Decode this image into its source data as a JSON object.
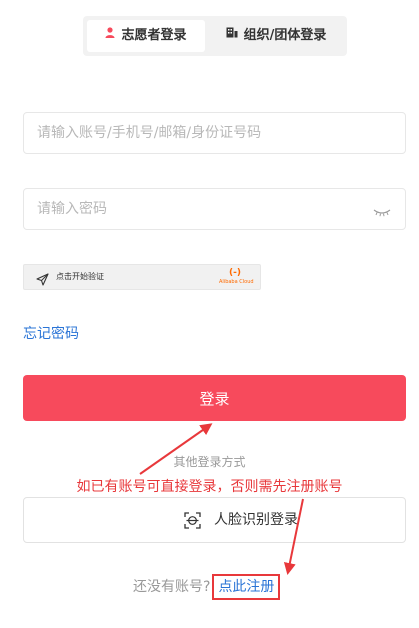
{
  "tabs": {
    "volunteer_label": "志愿者登录",
    "org_label": "组织/团体登录"
  },
  "form": {
    "account_placeholder": "请输入账号/手机号/邮箱/身份证号码",
    "password_placeholder": "请输入密码"
  },
  "captcha": {
    "label": "点击开始验证",
    "brand": "Alibaba Cloud"
  },
  "links": {
    "forgot_password": "忘记密码",
    "register_prompt": "还没有账号?",
    "register_link": "点此注册"
  },
  "buttons": {
    "login": "登录",
    "face_login": "人脸识别登录"
  },
  "other_methods_label": "其他登录方式",
  "annotation_text": "如已有账号可直接登录，否则需先注册账号",
  "colors": {
    "primary": "#f74a5c",
    "link": "#2a74d6",
    "annotation": "#e8383b"
  }
}
